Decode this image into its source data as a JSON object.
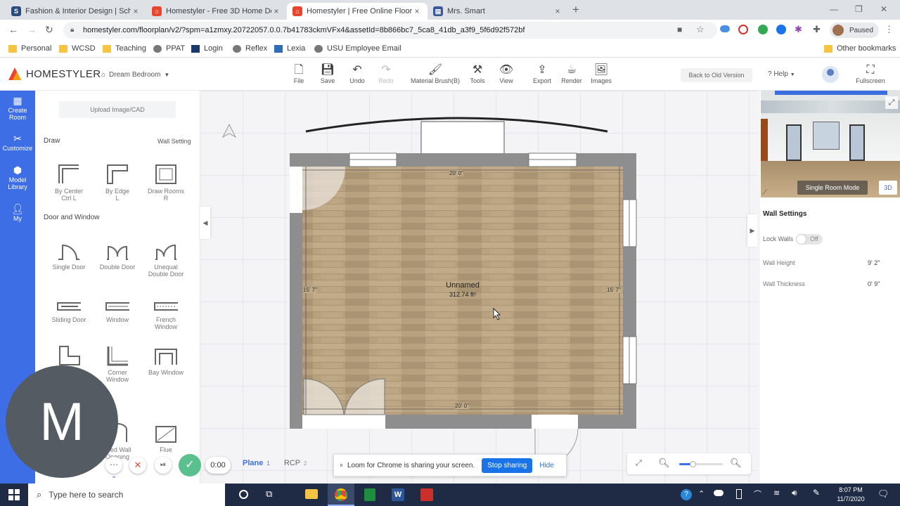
{
  "browser": {
    "tabs": [
      {
        "label": "Fashion & Interior Design | Schoo",
        "active": false,
        "icon": "schoology-icon"
      },
      {
        "label": "Homestyler - Free 3D Home Desi",
        "active": false,
        "icon": "homestyler-icon"
      },
      {
        "label": "Homestyler | Free Online Floor Pl",
        "active": true,
        "icon": "homestyler-icon"
      },
      {
        "label": "Mrs. Smart",
        "active": false,
        "icon": "docs-icon"
      }
    ],
    "url": "homestyler.com/floorplan/v2/?spm=a1zmxy.20722057.0.0.7b41783ckmVFx4&assetId=8b866bc7_5ca8_41db_a3f9_5f6d92f572bf",
    "profile_label": "Paused",
    "bookmarks": [
      "Personal",
      "WCSD",
      "Teaching",
      "PPAT",
      "Login",
      "Reflex",
      "Lexia",
      "USU Employee Email"
    ],
    "other_bookmarks": "Other bookmarks"
  },
  "app": {
    "brand": "HOMESTYLER",
    "project_name": "Dream Bedroom",
    "toolbar": [
      "File",
      "Save",
      "Undo",
      "Redo",
      "Material Brush(B)",
      "Tools",
      "View",
      "Export",
      "Render",
      "Images"
    ],
    "back_old_version": "Back to Old Version",
    "help": "Help",
    "fullscreen": "Fullscreen"
  },
  "left_nav": [
    "Create Room",
    "Customize",
    "Model Library",
    "My"
  ],
  "catalog": {
    "upload": "Upload Image/CAD",
    "draw_heading": "Draw",
    "wall_setting": "Wall Setting",
    "draw_items": [
      {
        "label": "By Center",
        "hotkey": "Ctrl L"
      },
      {
        "label": "By Edge",
        "hotkey": "L"
      },
      {
        "label": "Draw Rooms",
        "hotkey": "R"
      }
    ],
    "door_heading": "Door and Window",
    "door_items": [
      "Single Door",
      "Double Door",
      "Unequal Double Door",
      "Sliding Door",
      "Window",
      "French Window",
      "",
      "Corner Window",
      "Bay Window",
      "ched Wall Opening",
      "Flue"
    ]
  },
  "floorplan": {
    "room_name": "Unnamed",
    "room_area": "312.74 ft²",
    "dim_top": "20' 0\"",
    "dim_bottom": "20' 0\"",
    "dim_left": "15' 7\"",
    "dim_right": "15' 7\""
  },
  "bottom_bar": {
    "tabs": [
      "Plane",
      "RCP"
    ],
    "tab_numbers": [
      "1",
      "2"
    ],
    "share_message": "Loom for Chrome is sharing your screen.",
    "stop_sharing": "Stop sharing",
    "hide": "Hide",
    "recording_time": "0:00",
    "avatar_letter": "M"
  },
  "right_panel": {
    "mode_button": "Single Room Mode",
    "view_3d": "3D",
    "title": "Wall Settings",
    "lock_walls_label": "Lock Walls",
    "lock_walls_value": "Off",
    "wall_height_label": "Wall Height",
    "wall_height_value": "9' 2\"",
    "wall_thickness_label": "Wall Thickness",
    "wall_thickness_value": "0' 9\""
  },
  "taskbar": {
    "search_placeholder": "Type here to search",
    "time": "8:07 PM",
    "date": "11/7/2020"
  },
  "colors": {
    "accent": "#3d6ee6",
    "floor": "#b9a27f",
    "wall": "#8e8e8e"
  }
}
